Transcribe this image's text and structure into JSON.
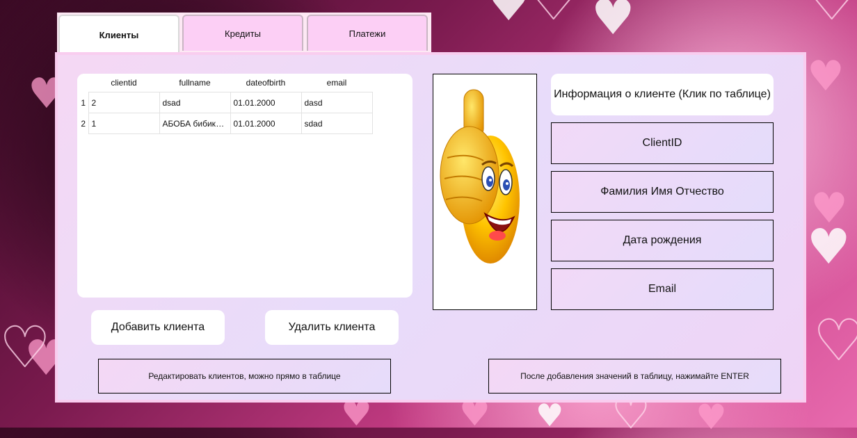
{
  "tabs": [
    "Клиенты",
    "Кредиты",
    "Платежи"
  ],
  "table": {
    "columns": [
      "clientid",
      "fullname",
      "dateofbirth",
      "email"
    ],
    "rows": [
      {
        "num": "1",
        "cells": [
          "2",
          "dsad",
          "01.01.2000",
          "dasd"
        ]
      },
      {
        "num": "2",
        "cells": [
          "1",
          "АБОБА бибика...",
          "01.01.2000",
          "sdad"
        ]
      }
    ]
  },
  "info": {
    "header": "Информация о клиенте (Клик по таблице)",
    "fields": [
      "ClientID",
      "Фамилия Имя Отчество",
      "Дата рождения",
      "Email"
    ]
  },
  "buttons": {
    "add": "Добавить клиента",
    "delete": "Удалить клиента"
  },
  "hints": {
    "edit": "Редактировать клиентов, можно прямо в таблице",
    "enter": "После добавления значений в таблицу, нажимайте ENTER"
  },
  "icons": {
    "photo": "thumbs-up-smiley-icon"
  }
}
